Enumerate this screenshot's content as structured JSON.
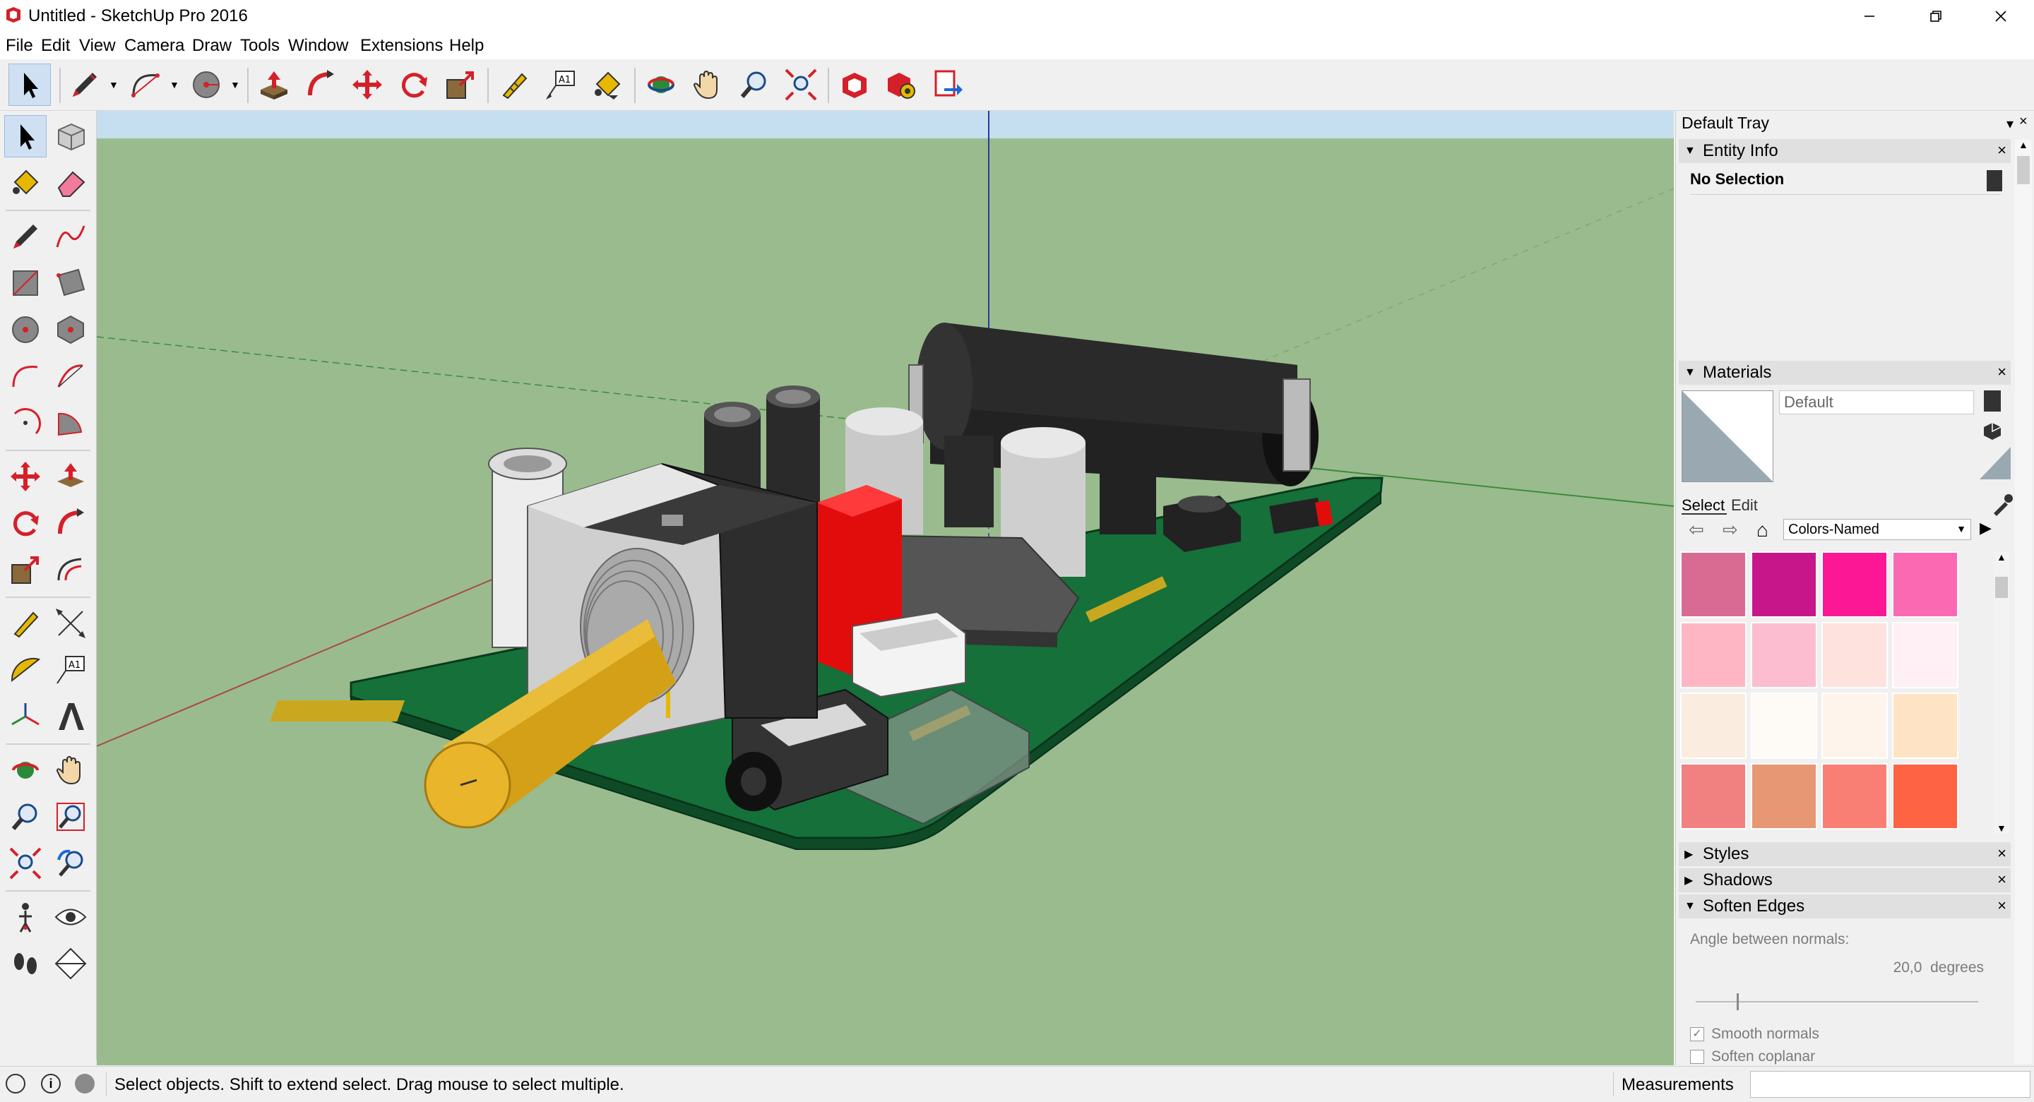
{
  "window": {
    "title": "Untitled - SketchUp Pro 2016"
  },
  "menu": [
    "File",
    "Edit",
    "View",
    "Camera",
    "Draw",
    "Tools",
    "Window",
    "Extensions",
    "Help"
  ],
  "tray": {
    "title": "Default Tray",
    "entity_info": {
      "title": "Entity Info",
      "selection": "No Selection"
    },
    "materials": {
      "title": "Materials",
      "name_value": "Default",
      "tab_select": "Select",
      "tab_edit": "Edit",
      "library": "Colors-Named",
      "swatches": [
        "#d96b93",
        "#c7168a",
        "#fc1795",
        "#fb69b3",
        "#feb6c5",
        "#fcbdd0",
        "#fee2de",
        "#fff0f5",
        "#faecde",
        "#fefaf5",
        "#fef4eb",
        "#fee4c4",
        "#f18080",
        "#e89775",
        "#f97f74",
        "#fe6344"
      ]
    },
    "styles": {
      "title": "Styles"
    },
    "shadows": {
      "title": "Shadows"
    },
    "soften": {
      "title": "Soften Edges",
      "angle_label": "Angle between normals:",
      "angle_value": "20,0  degrees",
      "smooth_label": "Smooth normals",
      "smooth_checked": true,
      "coplanar_label": "Soften coplanar",
      "coplanar_checked": false
    }
  },
  "status": {
    "message": "Select objects. Shift to extend select. Drag mouse to select multiple.",
    "measurements_label": "Measurements"
  }
}
